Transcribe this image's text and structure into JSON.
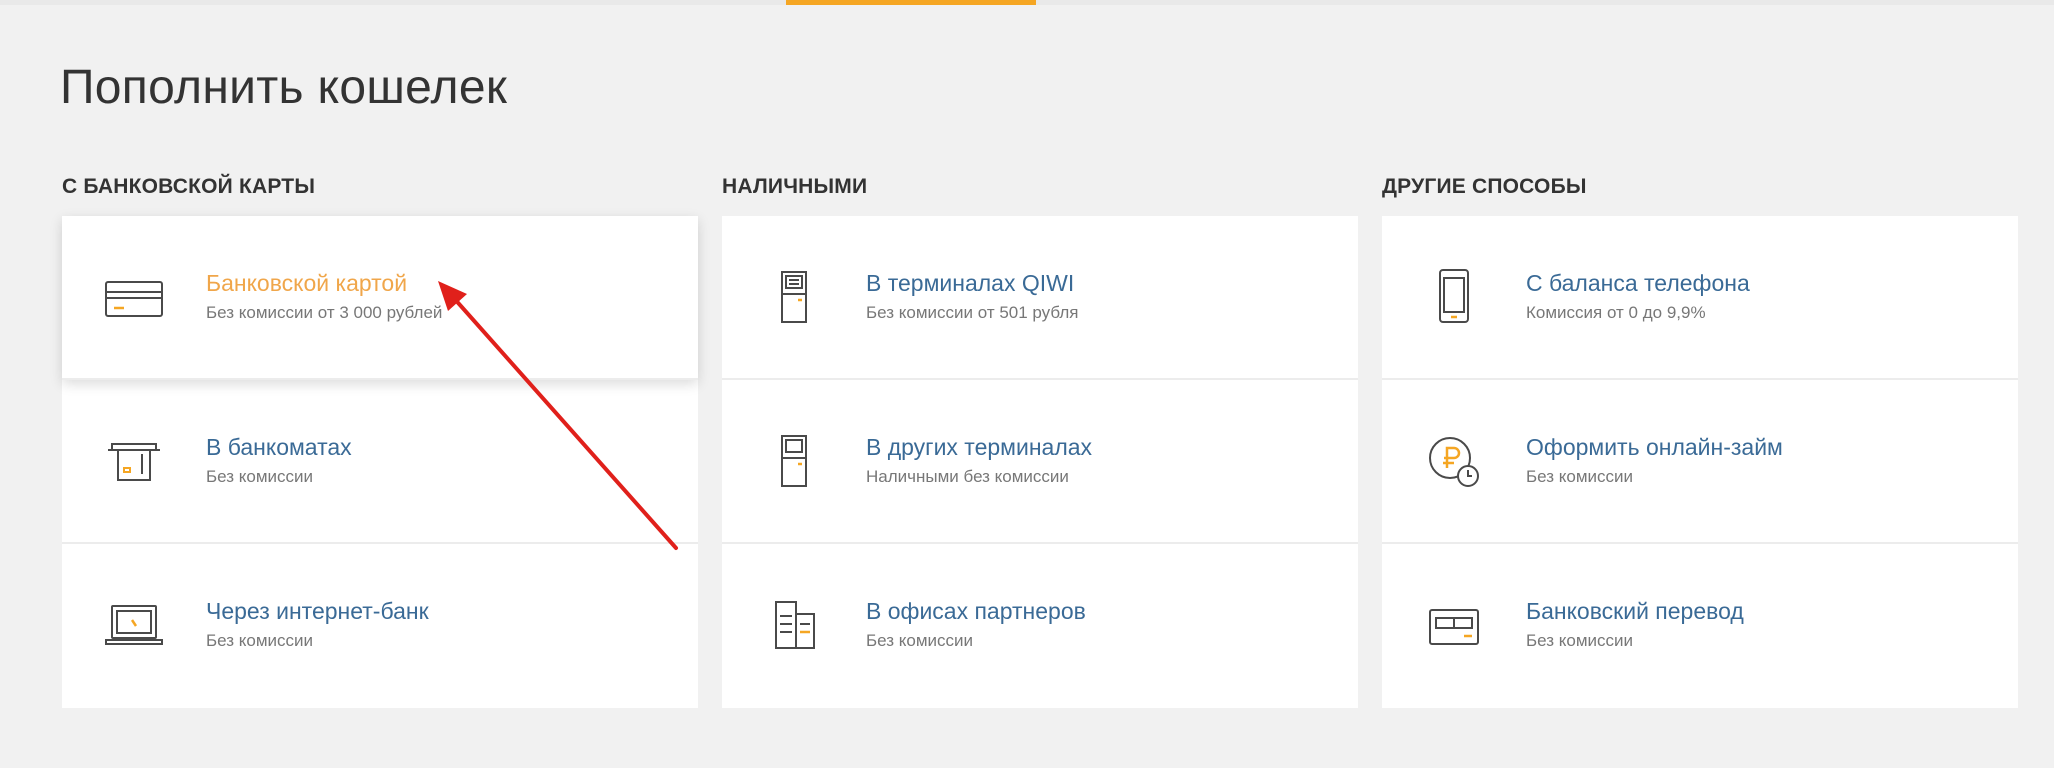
{
  "page_title": "Пополнить кошелек",
  "colors": {
    "accent": "#f5a623",
    "link": "#3a6a96",
    "active_link": "#f0a64a",
    "annotation_arrow": "#e0201b"
  },
  "sections": [
    {
      "title": "С БАНКОВСКОЙ КАРТЫ",
      "items": [
        {
          "title": "Банковской картой",
          "subtitle": "Без комиссии от 3 000 рублей",
          "icon": "credit-card-icon",
          "active": true
        },
        {
          "title": "В банкоматах",
          "subtitle": "Без комиссии",
          "icon": "atm-icon"
        },
        {
          "title": "Через интернет-банк",
          "subtitle": "Без комиссии",
          "icon": "laptop-icon"
        }
      ]
    },
    {
      "title": "НАЛИЧНЫМИ",
      "items": [
        {
          "title": "В терминалах QIWI",
          "subtitle": "Без комиссии от 501 рубля",
          "icon": "qiwi-terminal-icon"
        },
        {
          "title": "В других терминалах",
          "subtitle": "Наличными без комиссии",
          "icon": "terminal-icon"
        },
        {
          "title": "В офисах партнеров",
          "subtitle": "Без комиссии",
          "icon": "office-building-icon"
        }
      ]
    },
    {
      "title": "ДРУГИЕ СПОСОБЫ",
      "items": [
        {
          "title": "С баланса телефона",
          "subtitle": "Комиссия от 0 до 9,9%",
          "icon": "mobile-phone-icon"
        },
        {
          "title": "Оформить онлайн-займ",
          "subtitle": "Без комиссии",
          "icon": "ruble-clock-icon"
        },
        {
          "title": "Банковский перевод",
          "subtitle": "Без комиссии",
          "icon": "bank-transfer-icon"
        }
      ]
    }
  ]
}
